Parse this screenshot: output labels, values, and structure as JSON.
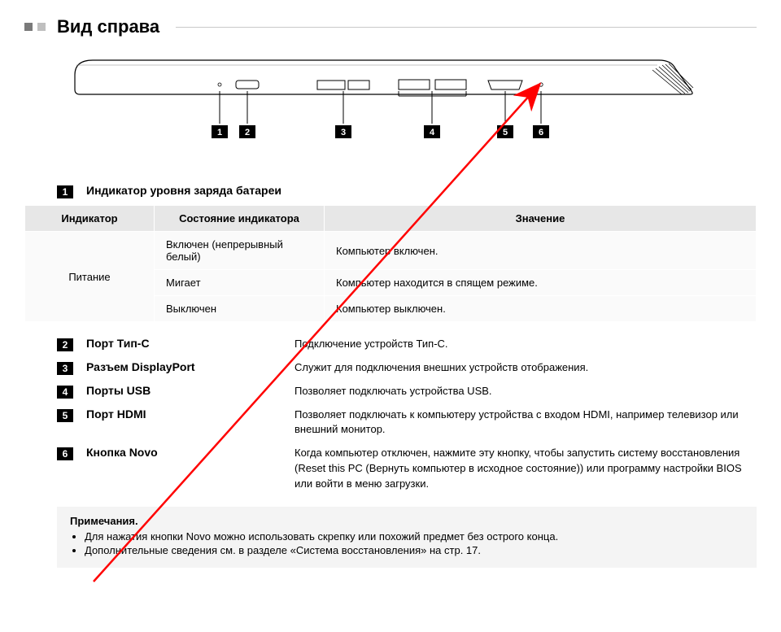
{
  "heading": "Вид справа",
  "diagram_callouts": [
    "1",
    "2",
    "3",
    "4",
    "5",
    "6"
  ],
  "item1": {
    "num": "1",
    "label": "Индикатор уровня заряда батареи"
  },
  "table": {
    "headers": {
      "c1": "Индикатор",
      "c2": "Состояние индикатора",
      "c3": "Значение"
    },
    "rowhead": "Питание",
    "rows": [
      {
        "state": "Включен (непрерывный белый)",
        "meaning": "Компьютер включен."
      },
      {
        "state": "Мигает",
        "meaning": "Компьютер находится в спящем режиме."
      },
      {
        "state": "Выключен",
        "meaning": "Компьютер выключен."
      }
    ]
  },
  "items": [
    {
      "num": "2",
      "label": "Порт Тип-C",
      "desc": "Подключение устройств Тип-C."
    },
    {
      "num": "3",
      "label": "Разъем DisplayPort",
      "desc": "Служит для подключения внешних устройств отображения."
    },
    {
      "num": "4",
      "label": "Порты USB",
      "desc": "Позволяет подключать устройства USB."
    },
    {
      "num": "5",
      "label": "Порт HDMI",
      "desc": "Позволяет подключать к компьютеру устройства с входом HDMI, например телевизор или внешний монитор."
    },
    {
      "num": "6",
      "label": "Кнопка Novo",
      "desc": "Когда компьютер отключен, нажмите эту кнопку, чтобы запустить систему восстановления (Reset this PC (Вернуть компьютер в исходное состояние)) или программу настройки BIOS или войти в меню загрузки."
    }
  ],
  "notes": {
    "title": "Примечания.",
    "lines": [
      "Для нажатия кнопки Novo можно использовать скрепку или похожий предмет без острого конца.",
      "Дополнительные сведения см. в разделе «Система восстановления» на стр. 17."
    ]
  }
}
